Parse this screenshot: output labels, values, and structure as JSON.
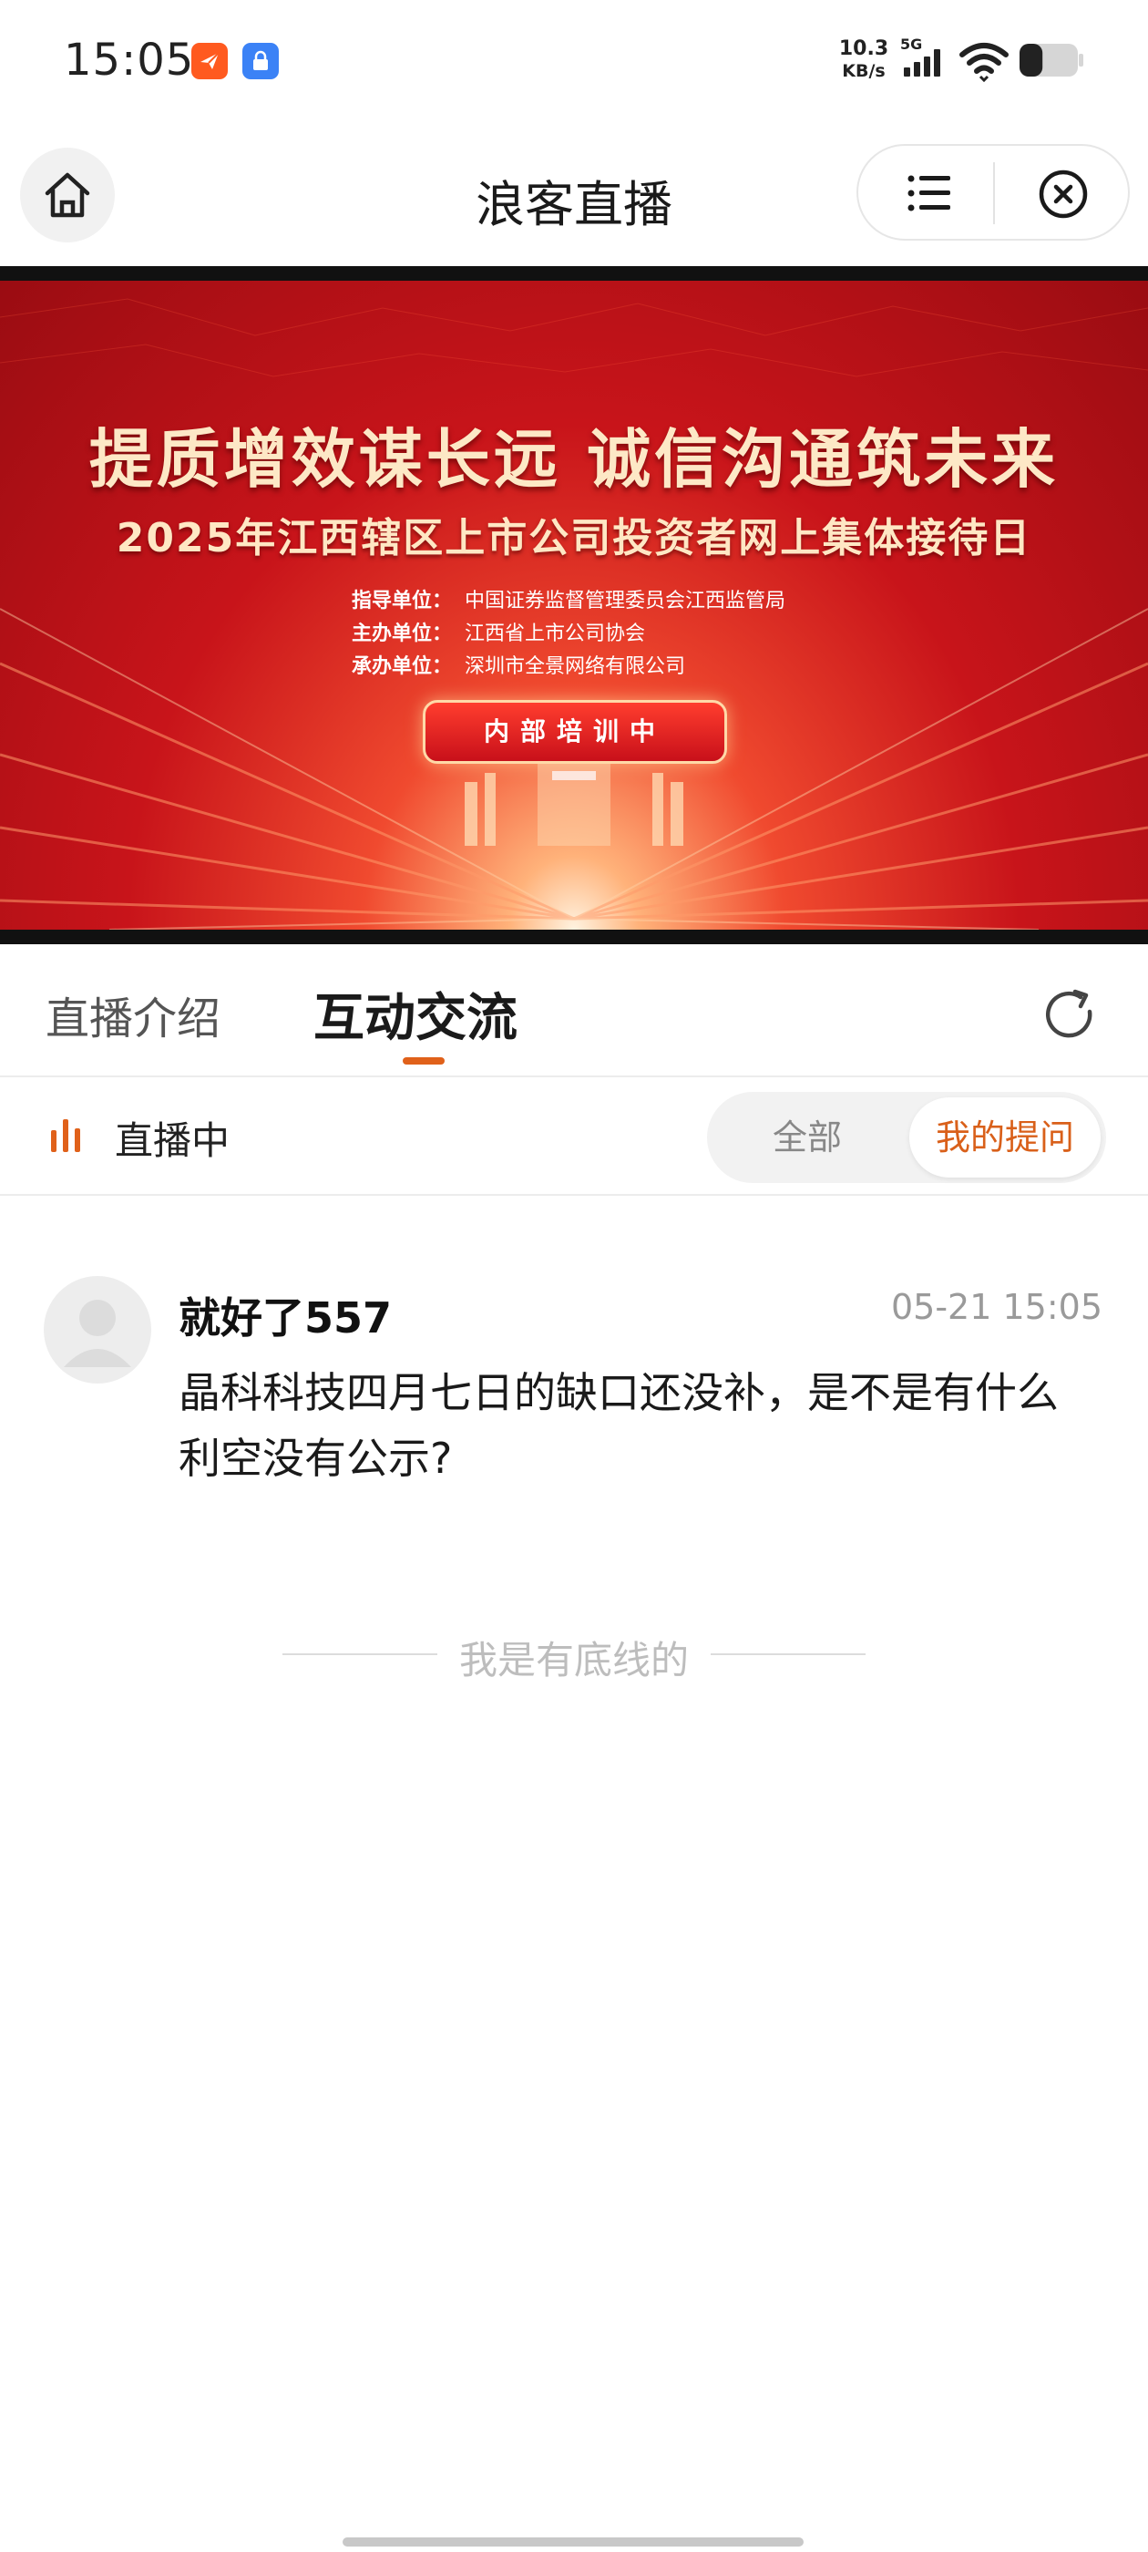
{
  "status_bar": {
    "time": "15:05",
    "network_speed_value": "10.3",
    "network_speed_unit": "KB/s",
    "network_type": "5G",
    "battery_level": 0.3,
    "notification_icons": [
      "message-arrow-icon",
      "lock-icon"
    ],
    "app1_color": "#ff5a1f",
    "app2_color": "#3b82f6"
  },
  "nav": {
    "title": "浪客直播",
    "icons": [
      "home-icon",
      "menu-list-icon",
      "close-circle-icon"
    ]
  },
  "banner": {
    "slogan": "提质增效谋长远  诚信沟通筑未来",
    "title": "2025年江西辖区上市公司投资者网上集体接待日",
    "info": [
      {
        "label": "指导单位：",
        "value": "中国证券监督管理委员会江西监管局"
      },
      {
        "label": "主办单位：",
        "value": "江西省上市公司协会"
      },
      {
        "label": "承办单位：",
        "value": "深圳市全景网络有限公司"
      }
    ],
    "status_button": "内部培训中",
    "colors": {
      "primary": "#c8141a",
      "gold": "#fde8c6"
    }
  },
  "tabs": {
    "items": [
      {
        "label": "直播介绍",
        "active": false
      },
      {
        "label": "互动交流",
        "active": true
      }
    ],
    "accent": "#e0611a",
    "refresh_icon": "refresh-icon"
  },
  "filter": {
    "live_label": "直播中",
    "live_icon": "live-bars-icon",
    "options": [
      {
        "label": "全部",
        "selected": false
      },
      {
        "label": "我的提问",
        "selected": true
      }
    ]
  },
  "questions": [
    {
      "user": "就好了557",
      "time": "05-21 15:05",
      "text": "晶科科技四月七日的缺口还没补，是不是有什么利空没有公示?"
    }
  ],
  "end_text": "我是有底线的"
}
